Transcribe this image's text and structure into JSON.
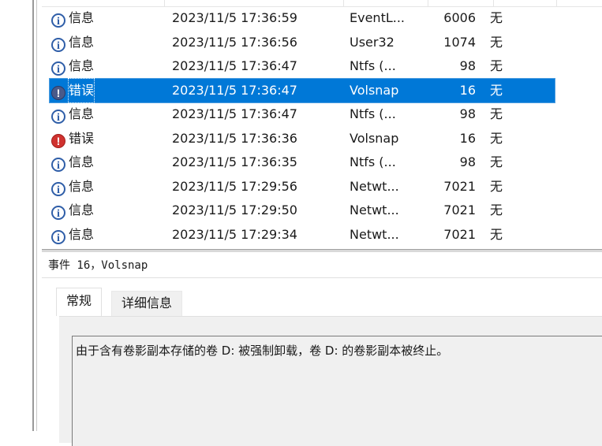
{
  "events": [
    {
      "level": "信息",
      "type": "info",
      "date": "2023/11/5 17:36:59",
      "source": "EventL...",
      "id": "6006",
      "task": "无",
      "selected": false
    },
    {
      "level": "信息",
      "type": "info",
      "date": "2023/11/5 17:36:56",
      "source": "User32",
      "id": "1074",
      "task": "无",
      "selected": false
    },
    {
      "level": "信息",
      "type": "info",
      "date": "2023/11/5 17:36:47",
      "source": "Ntfs (...",
      "id": "98",
      "task": "无",
      "selected": false
    },
    {
      "level": "错误",
      "type": "error",
      "date": "2023/11/5 17:36:47",
      "source": "Volsnap",
      "id": "16",
      "task": "无",
      "selected": true
    },
    {
      "level": "信息",
      "type": "info",
      "date": "2023/11/5 17:36:47",
      "source": "Ntfs (...",
      "id": "98",
      "task": "无",
      "selected": false
    },
    {
      "level": "错误",
      "type": "error",
      "date": "2023/11/5 17:36:36",
      "source": "Volsnap",
      "id": "16",
      "task": "无",
      "selected": false
    },
    {
      "level": "信息",
      "type": "info",
      "date": "2023/11/5 17:36:35",
      "source": "Ntfs (...",
      "id": "98",
      "task": "无",
      "selected": false
    },
    {
      "level": "信息",
      "type": "info",
      "date": "2023/11/5 17:29:56",
      "source": "Netwt...",
      "id": "7021",
      "task": "无",
      "selected": false
    },
    {
      "level": "信息",
      "type": "info",
      "date": "2023/11/5 17:29:50",
      "source": "Netwt...",
      "id": "7021",
      "task": "无",
      "selected": false
    },
    {
      "level": "信息",
      "type": "info",
      "date": "2023/11/5 17:29:34",
      "source": "Netwt...",
      "id": "7021",
      "task": "无",
      "selected": false
    }
  ],
  "icons": {
    "info": "info-icon",
    "error": "error-icon"
  },
  "detail": {
    "title": "事件 16，Volsnap",
    "tabs": {
      "general": "常规",
      "details": "详细信息"
    },
    "message": "由于含有卷影副本存储的卷 D: 被强制卸载，卷 D: 的卷影副本被终止。"
  },
  "colors": {
    "selection": "#0078d7",
    "error": "#d0322f",
    "info": "#2f5ea8"
  }
}
